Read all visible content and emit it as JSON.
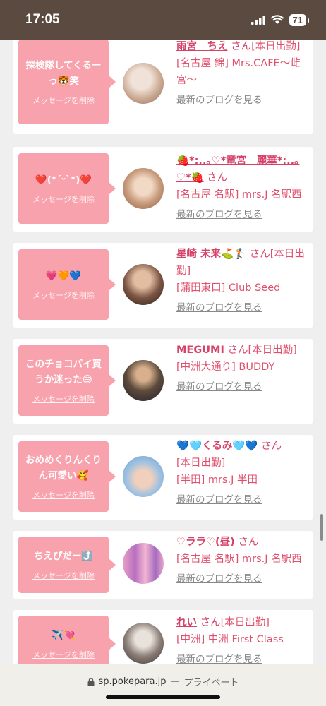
{
  "status_bar": {
    "time": "17:05",
    "battery": "71"
  },
  "cards": [
    {
      "message": "探検隊してくるーっ🐯笑",
      "delete_label": "メッセージを削除",
      "name": "雨宮　ちえ",
      "san": "さん",
      "detail_lines": [
        "[本日出勤]",
        "[名古屋 錦] Mrs.CAFE～雌宮～"
      ],
      "blog_link": "最新のブログを見る",
      "avatar_colors": [
        "#e8d8cc",
        "#c7a48b"
      ]
    },
    {
      "message": "❤️(*´ᵕ`*)❤️",
      "delete_label": "メッセージを削除",
      "name": "🍓*:..｡♡*竜宮　麗華*:..｡♡*🍓",
      "san": "さん",
      "detail_lines": [
        "[名古屋 名駅] mrs.J 名駅西"
      ],
      "blog_link": "最新のブログを見る",
      "avatar_colors": [
        "#d8b89a",
        "#a2705a"
      ]
    },
    {
      "message": "💗🧡💙",
      "delete_label": "メッセージを削除",
      "name": "星崎 未来⛳️🏌️",
      "san": "さん",
      "detail_lines": [
        "[本日出勤]",
        "[蒲田東口] Club Seed"
      ],
      "blog_link": "最新のブログを見る",
      "avatar_colors": [
        "#b08868",
        "#3b2a22"
      ]
    },
    {
      "message": "このチョコパイ買うか迷った😅",
      "delete_label": "メッセージを削除",
      "name": "MEGUMI",
      "san": "さん",
      "detail_lines": [
        "[本日出勤]",
        "[中洲大通り] BUDDY"
      ],
      "blog_link": "最新のブログを見る",
      "avatar_colors": [
        "#6f5c48",
        "#2a2a38"
      ]
    },
    {
      "message": "おめめくりんくりん可愛い🥰",
      "delete_label": "メッセージを削除",
      "name": "💙🩵くるみ🩵💙",
      "san": "さん",
      "detail_lines": [
        "[本日出勤]",
        "[半田] mrs.J 半田"
      ],
      "blog_link": "最新のブログを見る",
      "avatar_colors": [
        "#bcd6ee",
        "#e6c0b0"
      ]
    },
    {
      "message": "ちえぴだー⤴️",
      "delete_label": "メッセージを削除",
      "name": "♡ララ♡(昼)",
      "san": "さん",
      "detail_lines": [
        "[名古屋 名駅] mrs.J 名駅西"
      ],
      "blog_link": "最新のブログを見る",
      "avatar_colors": [
        "#f2b6d2",
        "#b673c4"
      ]
    },
    {
      "message": "✈️💘",
      "delete_label": "メッセージを削除",
      "name": "れい",
      "san": "さん",
      "detail_lines": [
        "[本日出勤]",
        "[中洲] 中洲 First Class"
      ],
      "blog_link": "最新のブログを見る",
      "avatar_colors": [
        "#d9d3cc",
        "#4a3f3a"
      ]
    }
  ],
  "bottom_bar": {
    "url": "sp.pokepara.jp",
    "separator": "—",
    "mode": "プライベート"
  }
}
